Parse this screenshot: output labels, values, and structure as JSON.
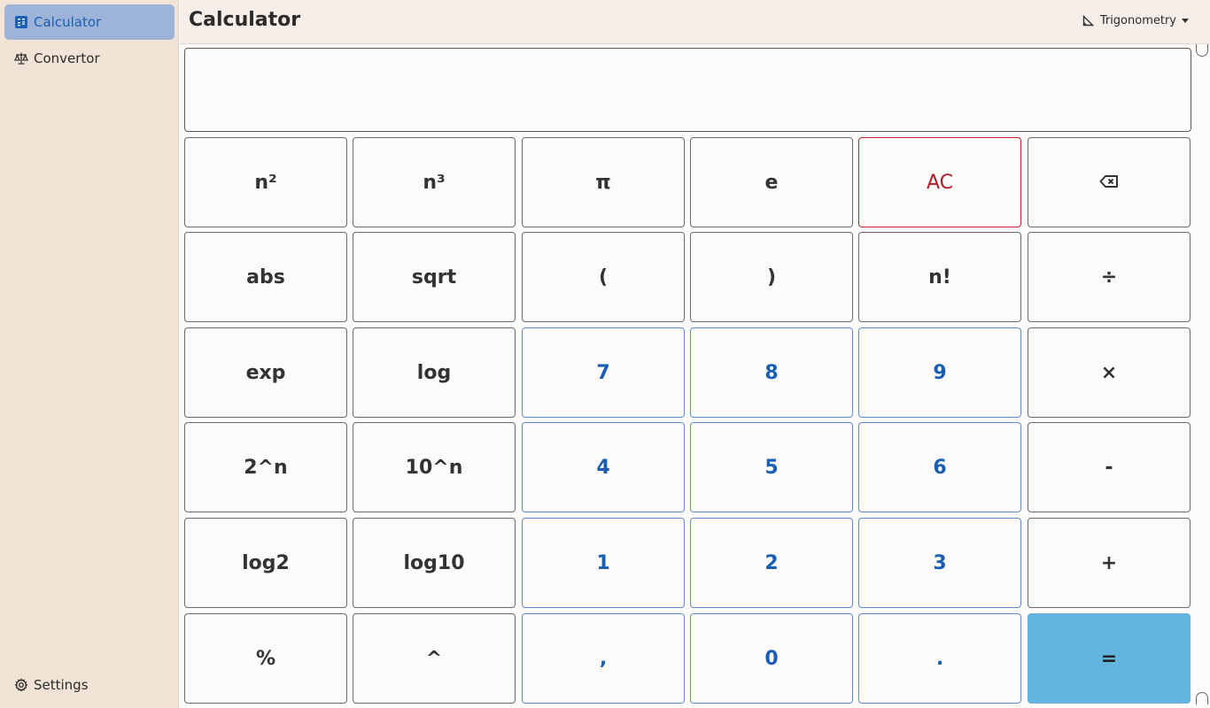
{
  "sidebar": {
    "items": [
      {
        "label": "Calculator",
        "icon": "calculator-icon",
        "active": true
      },
      {
        "label": "Convertor",
        "icon": "scale-icon",
        "active": false
      }
    ],
    "settings_label": "Settings"
  },
  "header": {
    "title": "Calculator",
    "mode_label": "Trigonometry"
  },
  "display": {
    "value": ""
  },
  "colors": {
    "accent": "#1a5fb4",
    "clear": "#b01c28",
    "equals": "#63b4df",
    "sidebar_bg": "#f1e4d6"
  },
  "keys": [
    [
      "n²",
      "n³",
      "π",
      "e",
      "AC",
      "⌫"
    ],
    [
      "abs",
      "sqrt",
      "(",
      ")",
      "n!",
      "÷"
    ],
    [
      "exp",
      "log",
      "7",
      "8",
      "9",
      "×"
    ],
    [
      "2^n",
      "10^n",
      "4",
      "5",
      "6",
      "-"
    ],
    [
      "log2",
      "log10",
      "1",
      "2",
      "3",
      "+"
    ],
    [
      "%",
      "^",
      ",",
      "0",
      ".",
      "="
    ]
  ]
}
